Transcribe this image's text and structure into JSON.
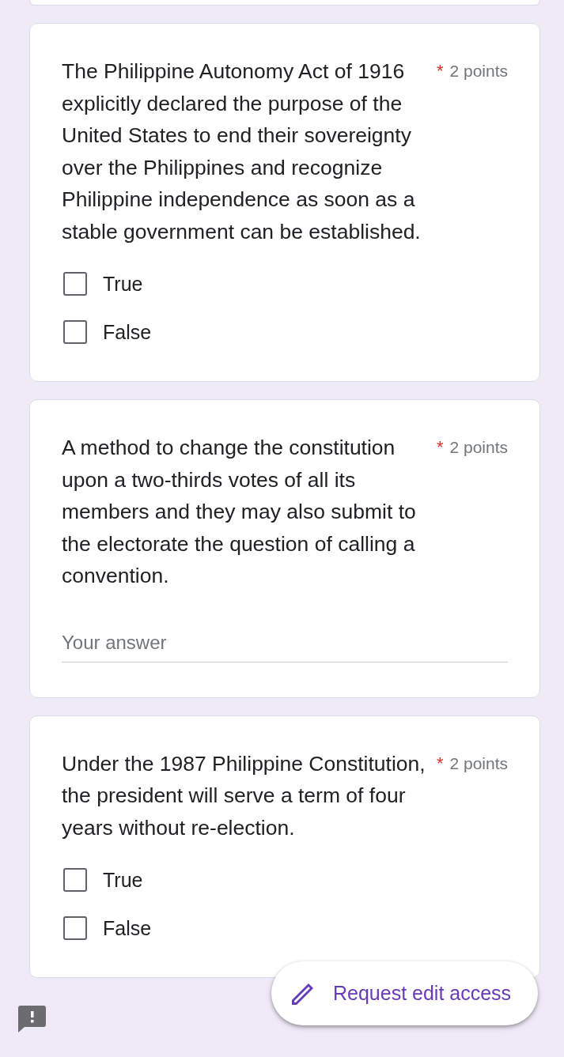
{
  "questions": [
    {
      "kind": "choice",
      "text": "The Philippine Autonomy Act of 1916 explicitly declared the purpose of the United States to end their sovereignty over the Philippines and recognize Philippine independence as soon as a stable government can be established.",
      "required_mark": "*",
      "points": "2 points",
      "options": [
        {
          "label": "True",
          "checked": false
        },
        {
          "label": "False",
          "checked": false
        }
      ]
    },
    {
      "kind": "text",
      "text": "A method to change the constitution upon a two-thirds votes of all its members and they may also submit to the electorate the question of calling a convention.",
      "required_mark": "*",
      "points": "2 points",
      "placeholder": "Your answer"
    },
    {
      "kind": "choice",
      "text": "Under the 1987 Philippine Constitution, the president will serve a term of four years without re-election.",
      "required_mark": "*",
      "points": "2 points",
      "options": [
        {
          "label": "True",
          "checked": false
        },
        {
          "label": "False",
          "checked": false
        }
      ]
    }
  ],
  "fab": {
    "label": "Request edit access"
  }
}
